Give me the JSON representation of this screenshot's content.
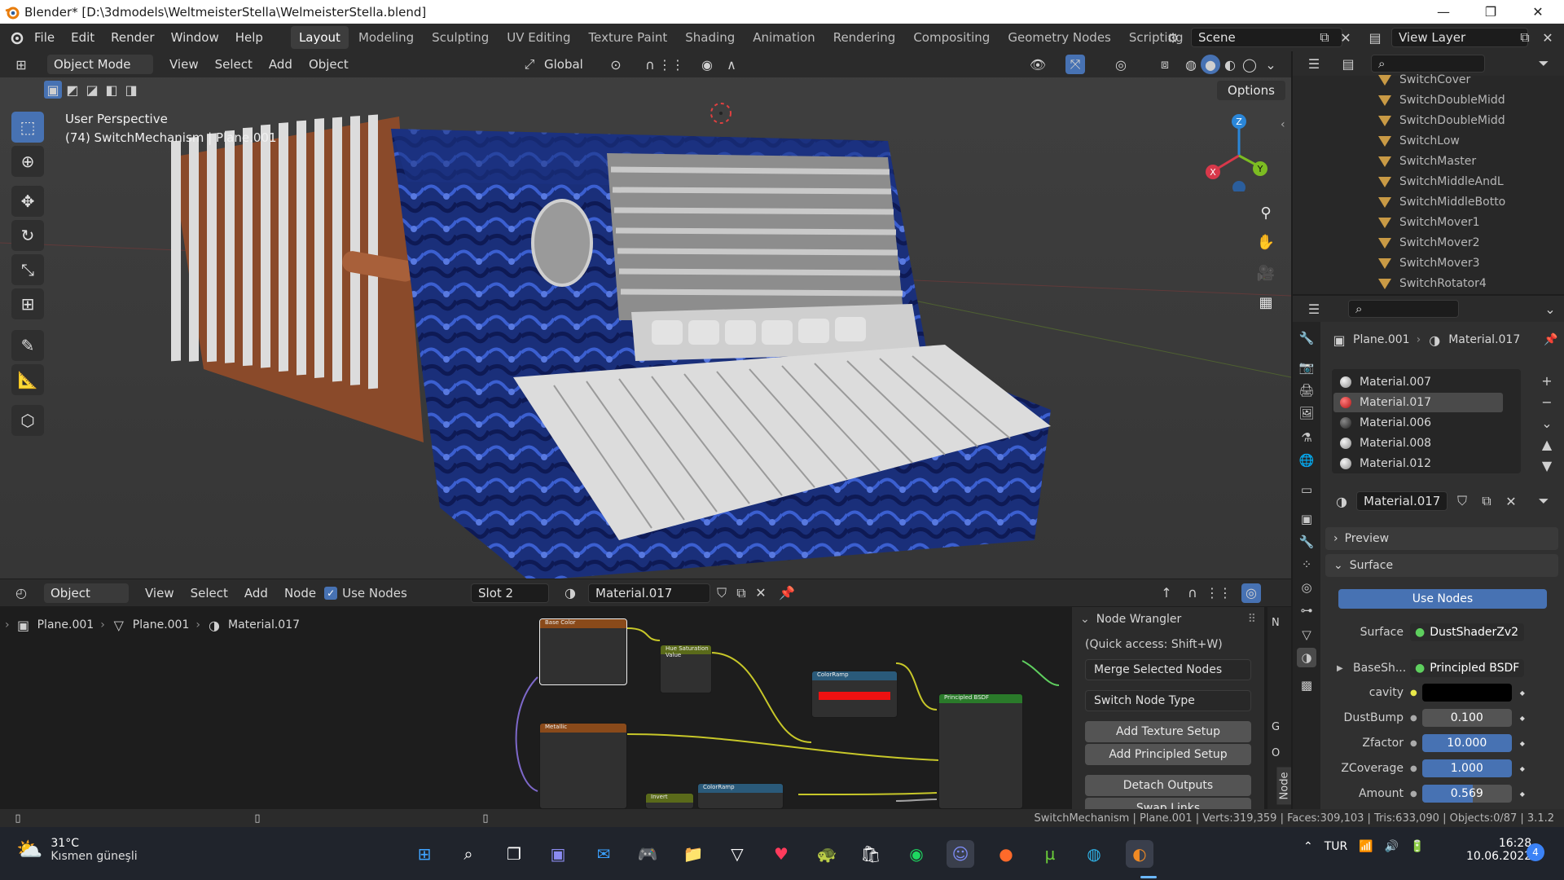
{
  "titlebar": {
    "title": "Blender* [D:\\3dmodels\\WeltmeisterStella\\WelmeisterStella.blend]",
    "minimize": "—",
    "maximize": "❐",
    "close": "✕"
  },
  "menu": [
    "File",
    "Edit",
    "Render",
    "Window",
    "Help"
  ],
  "workspaces": [
    "Layout",
    "Modeling",
    "Sculpting",
    "UV Editing",
    "Texture Paint",
    "Shading",
    "Animation",
    "Rendering",
    "Compositing",
    "Geometry Nodes",
    "Scripting",
    "+"
  ],
  "scene": {
    "name": "Scene",
    "view_layer": "View Layer"
  },
  "viewport": {
    "mode": "Object Mode",
    "menus": [
      "View",
      "Select",
      "Add",
      "Object"
    ],
    "transform": "Global",
    "options_label": "Options",
    "overlay_title": "User Perspective",
    "overlay_sub": "(74) SwitchMechanism | Plane.001",
    "gizmo": {
      "x": "X",
      "y": "Y",
      "z": "Z"
    }
  },
  "outliner": {
    "items": [
      "SwitchCover",
      "SwitchDoubleMidd",
      "SwitchDoubleMidd",
      "SwitchLow",
      "SwitchMaster",
      "SwitchMiddleAndL",
      "SwitchMiddleBotto",
      "SwitchMover1",
      "SwitchMover2",
      "SwitchMover3",
      "SwitchRotator4"
    ]
  },
  "properties": {
    "breadcrumb_object": "Plane.001",
    "breadcrumb_material": "Material.017",
    "materials": [
      "Material.007",
      "Material.017",
      "Material.006",
      "Material.008",
      "Material.012"
    ],
    "selected_material_index": 1,
    "active_material": "Material.017",
    "preview_label": "Preview",
    "surface_label": "Surface",
    "use_nodes": "Use Nodes",
    "fields": [
      {
        "label": "Surface",
        "value": "DustShaderZv2",
        "kind": "link"
      },
      {
        "label": "BaseSh...",
        "value": "Principled BSDF",
        "kind": "link"
      },
      {
        "label": "cavity",
        "value": "",
        "kind": "color"
      },
      {
        "label": "DustBump",
        "value": "0.100",
        "kind": "number"
      },
      {
        "label": "Zfactor",
        "value": "10.000",
        "kind": "blue"
      },
      {
        "label": "ZCoverage",
        "value": "1.000",
        "kind": "blue"
      },
      {
        "label": "Amount",
        "value": "0.569",
        "kind": "blue"
      }
    ],
    "amount_fill": 0.569
  },
  "node_editor": {
    "editor_type": "Object",
    "menus": [
      "View",
      "Select",
      "Add",
      "Node"
    ],
    "use_nodes": "Use Nodes",
    "slot": "Slot 2",
    "material": "Material.017",
    "breadcrumb": [
      "Plane.001",
      "Plane.001",
      "Material.017"
    ],
    "nodes": [
      "Base Color",
      "Hue Saturation Value",
      "ColorRamp",
      "Principled BSDF",
      "Metallic",
      "Invert",
      "ColorRamp"
    ],
    "side_tabs": [
      "N",
      "G",
      "O",
      "Node"
    ]
  },
  "node_wrangler": {
    "title": "Node Wrangler",
    "hint": "(Quick access: Shift+W)",
    "dropdowns": [
      "Merge Selected Nodes",
      "Switch Node Type"
    ],
    "buttons": [
      "Add Texture Setup",
      "Add Principled Setup",
      "Detach Outputs",
      "Swap Links"
    ]
  },
  "statusbar": {
    "stats": "SwitchMechanism | Plane.001 | Verts:319,359 | Faces:309,103 | Tris:633,090 | Objects:0/87 | 3.1.2"
  },
  "taskbar": {
    "weather_temp": "31°C",
    "weather_desc": "Kısmen güneşli",
    "lang": "TUR",
    "time": "16:28",
    "date": "10.06.2022",
    "notifications": "4"
  },
  "colors": {
    "accent": "#4772b3",
    "object_orange": "#c99a45",
    "field_blue": "#4772b3",
    "selected_material": "#e03a3a"
  }
}
